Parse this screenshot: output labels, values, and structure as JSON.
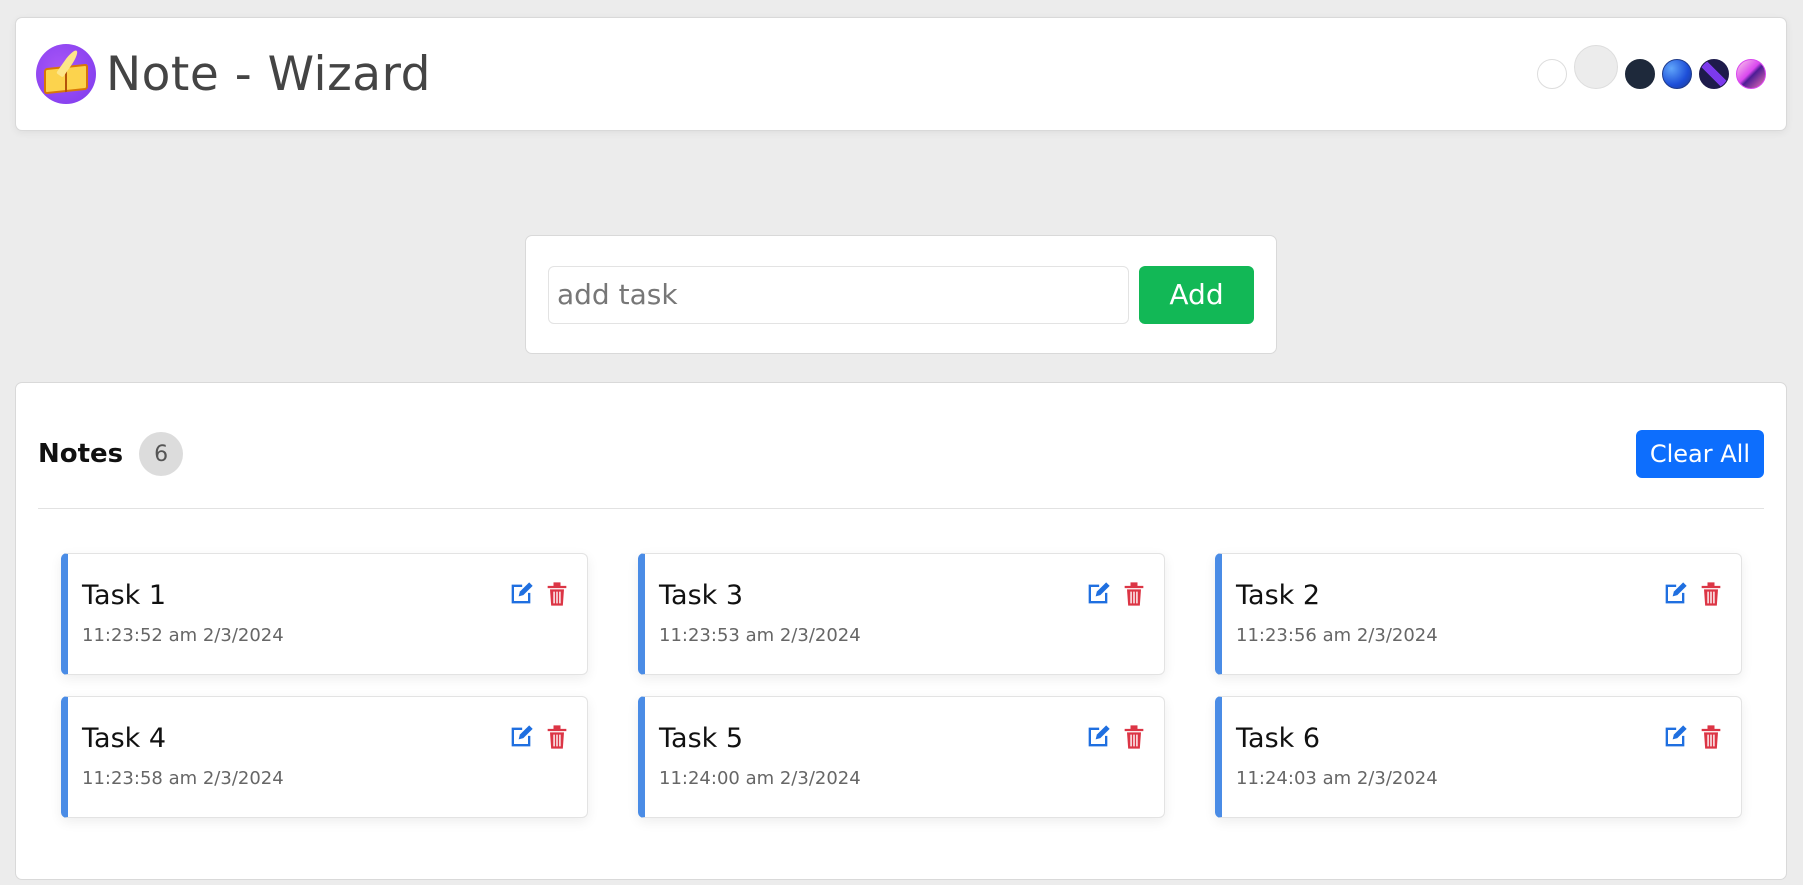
{
  "app": {
    "title": "Note - Wizard",
    "logo_icon": "book-quill-icon"
  },
  "themes": [
    {
      "name": "light",
      "color": "#ffffff"
    },
    {
      "name": "gray",
      "color": "#ececec",
      "active": true
    },
    {
      "name": "dark",
      "color": "#1e293b"
    },
    {
      "name": "blue",
      "color": "#2563eb"
    },
    {
      "name": "violet",
      "color": "#4f1fa8"
    },
    {
      "name": "pink",
      "color": "#d946ef"
    }
  ],
  "add_task": {
    "placeholder": "add task",
    "button_label": "Add"
  },
  "notes": {
    "title": "Notes",
    "count": "6",
    "clear_label": "Clear All",
    "items": [
      {
        "title": "Task 1",
        "time": "11:23:52 am 2/3/2024"
      },
      {
        "title": "Task 3",
        "time": "11:23:53 am 2/3/2024"
      },
      {
        "title": "Task 2",
        "time": "11:23:56 am 2/3/2024"
      },
      {
        "title": "Task 4",
        "time": "11:23:58 am 2/3/2024"
      },
      {
        "title": "Task 5",
        "time": "11:24:00 am 2/3/2024"
      },
      {
        "title": "Task 6",
        "time": "11:24:03 am 2/3/2024"
      }
    ]
  },
  "colors": {
    "accent": "#0d6efd",
    "add_button": "#12b856",
    "note_border": "#4a8ce6",
    "edit_icon": "#1f6fe0",
    "delete_icon": "#dc3545"
  }
}
